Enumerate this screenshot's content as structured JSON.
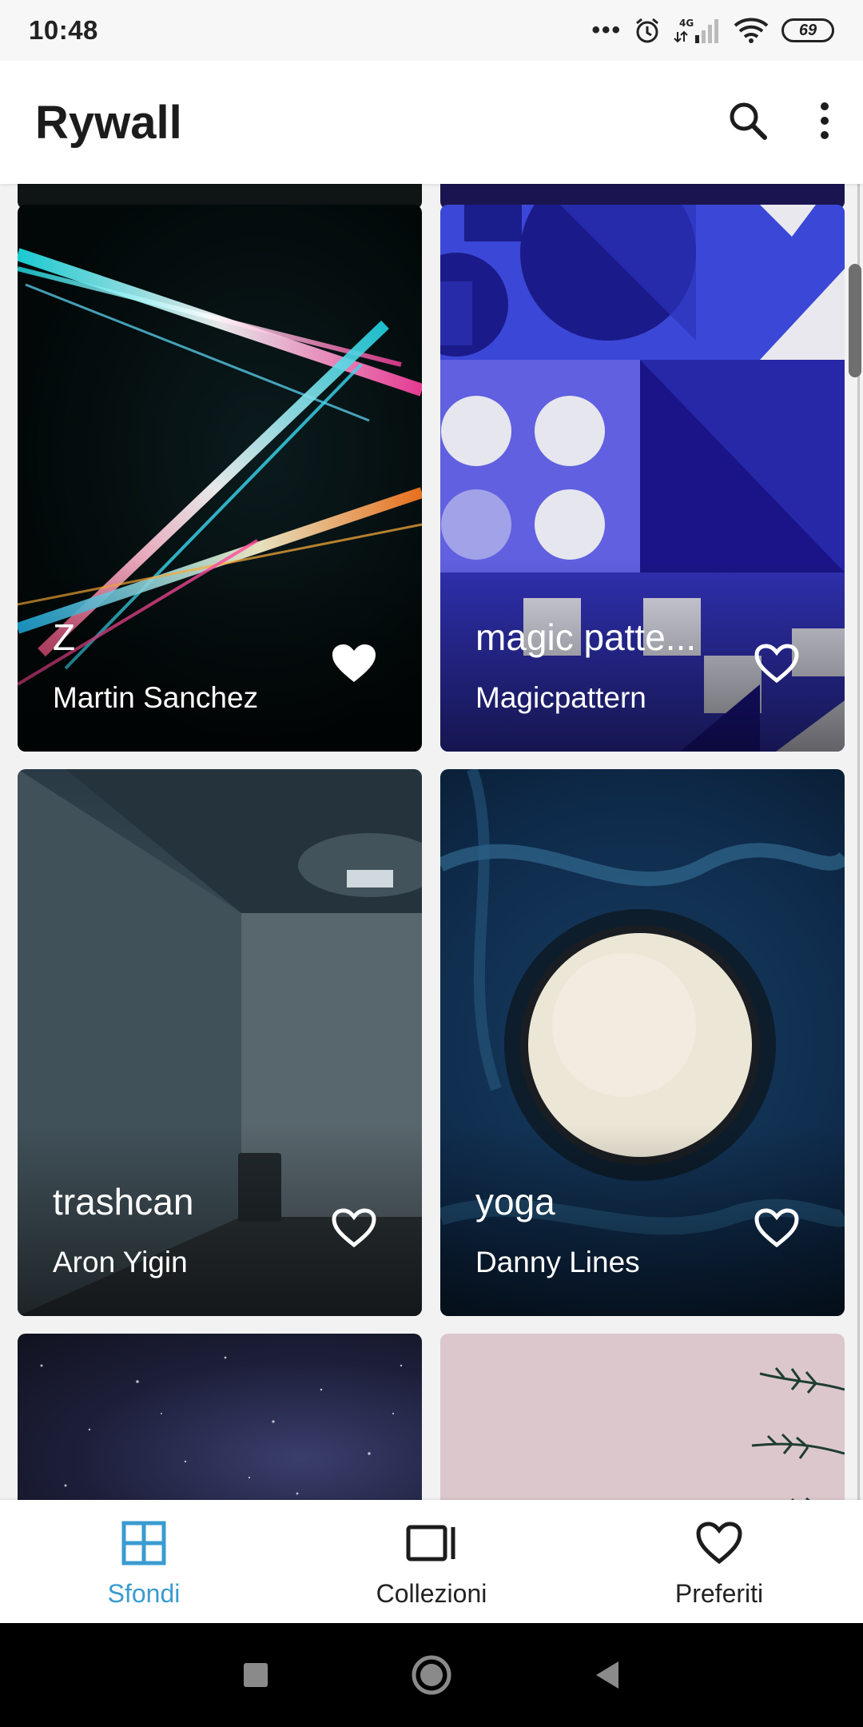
{
  "status_bar": {
    "time": "10:48",
    "dots": "•••",
    "network": "4G",
    "battery": "69"
  },
  "app_bar": {
    "title": "Rywall"
  },
  "cards": [
    {
      "title": "Z",
      "author": "Martin Sanchez",
      "favorited": true
    },
    {
      "title": "magic patte...",
      "author": "Magicpattern",
      "favorited": false
    },
    {
      "title": "trashcan",
      "author": "Aron Yigin",
      "favorited": false
    },
    {
      "title": "yoga",
      "author": "Danny Lines",
      "favorited": false
    }
  ],
  "bottom_nav": {
    "items": [
      {
        "label": "Sfondi",
        "active": true
      },
      {
        "label": "Collezioni",
        "active": false
      },
      {
        "label": "Preferiti",
        "active": false
      }
    ]
  },
  "colors": {
    "accent": "#3a9bd0",
    "app_bar_bg": "#ffffff",
    "status_bar_bg": "#f7f7f7",
    "system_nav_bg": "#000000"
  },
  "icons": {
    "search": "search-icon",
    "menu": "more-vert-icon",
    "favorite": "heart-icon",
    "wallpapers": "grid-icon",
    "collections": "collections-icon"
  }
}
